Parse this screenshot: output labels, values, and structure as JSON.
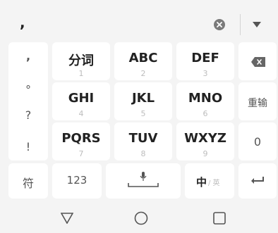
{
  "input_bar": {
    "typed_text": ","
  },
  "punctuation": [
    ",",
    "°",
    "?",
    "!"
  ],
  "keys": {
    "fenci": {
      "main": "分词",
      "sub": "1"
    },
    "abc": {
      "main": "ABC",
      "sub": "2"
    },
    "def": {
      "main": "DEF",
      "sub": "3"
    },
    "ghi": {
      "main": "GHI",
      "sub": "4"
    },
    "jkl": {
      "main": "JKL",
      "sub": "5"
    },
    "mno": {
      "main": "MNO",
      "sub": "6"
    },
    "pqrs": {
      "main": "PQRS",
      "sub": "7"
    },
    "tuv": {
      "main": "TUV",
      "sub": "8"
    },
    "wxyz": {
      "main": "WXYZ",
      "sub": "9"
    },
    "retype": "重输",
    "zero": "0",
    "symbol": "符",
    "numbers": "123",
    "lang_main": "中",
    "lang_sub": "/ 英"
  },
  "colors": {
    "background": "#f4f4f4",
    "key": "#ffffff",
    "text": "#222222",
    "subtext": "#bdbdbd",
    "lang_accent": "#e0453b"
  },
  "icons": {
    "clear": "clear-icon",
    "collapse": "chevron-down-icon",
    "backspace": "backspace-icon",
    "mic": "microphone-icon",
    "enter": "enter-icon",
    "back": "back-triangle-icon",
    "home": "home-circle-icon",
    "recents": "recents-square-icon"
  }
}
